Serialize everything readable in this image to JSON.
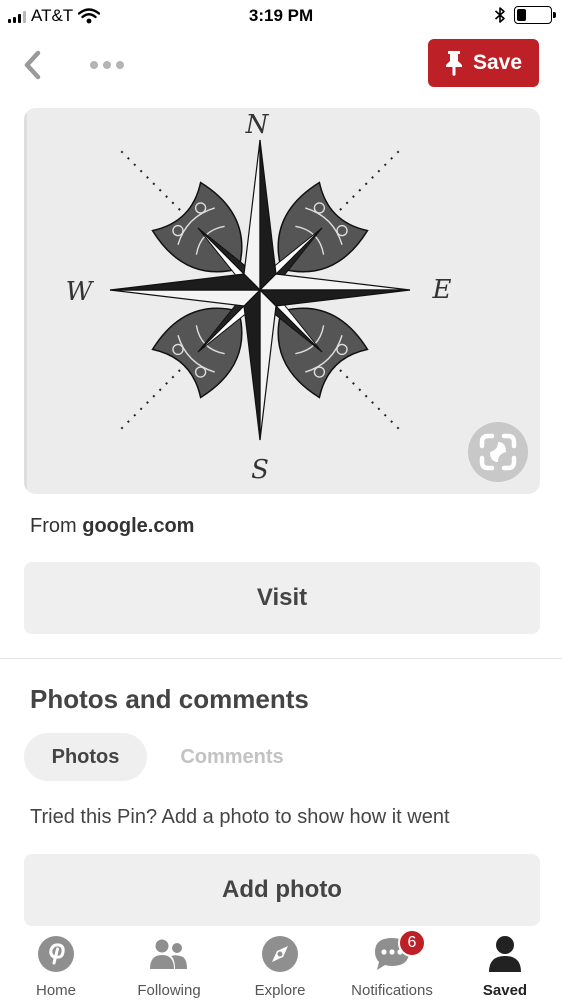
{
  "status_bar": {
    "carrier": "AT&T",
    "time": "3:19 PM",
    "battery_level": 0.3
  },
  "header": {
    "save_label": "Save",
    "back_icon": "chevron-left-icon",
    "more_icon": "more-dots-icon",
    "save_icon": "pushpin-icon"
  },
  "pin": {
    "compass_letters": {
      "n": "N",
      "e": "E",
      "s": "S",
      "w": "W"
    },
    "lens_icon": "visual-search-icon"
  },
  "source": {
    "prefix": "From",
    "domain": "google.com"
  },
  "visit_label": "Visit",
  "photos_section": {
    "title": "Photos and comments",
    "tabs": [
      {
        "label": "Photos",
        "active": true
      },
      {
        "label": "Comments",
        "active": false
      }
    ],
    "prompt": "Tried this Pin? Add a photo to show how it went",
    "add_photo_label": "Add photo"
  },
  "bottom_nav": {
    "items": [
      {
        "label": "Home",
        "icon": "pinterest-logo-icon"
      },
      {
        "label": "Following",
        "icon": "people-icon"
      },
      {
        "label": "Explore",
        "icon": "compass-icon"
      },
      {
        "label": "Notifications",
        "icon": "speech-bubble-icon",
        "badge": "6"
      },
      {
        "label": "Saved",
        "icon": "person-icon",
        "active": true
      }
    ]
  },
  "colors": {
    "brand_red": "#bd2026",
    "button_gray": "#efefef",
    "inactive_text": "#c2c2c2"
  }
}
